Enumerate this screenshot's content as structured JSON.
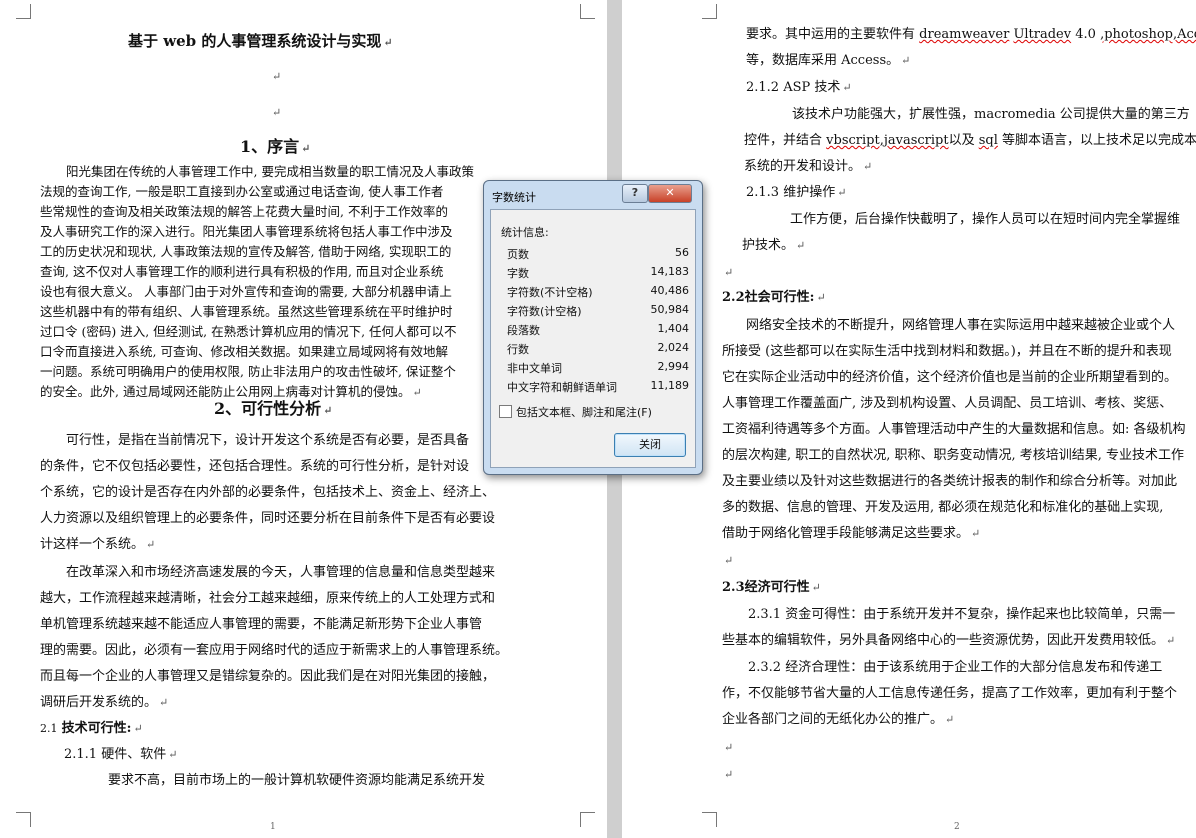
{
  "document": {
    "page1": {
      "title": "基于 web 的人事管理系统设计与实现",
      "section1": "1、序言",
      "intro_lines": [
        "阳光集团在传统的人事管理工作中, 要完成相当数量的职工情况及人事政策",
        "法规的查询工作, 一般是职工直接到办公室或通过电话查询, 使人事工作者",
        "些常规性的查询及相关政策法规的解答上花费大量时间, 不利于工作效率的",
        "及人事研究工作的深入进行。阳光集团人事管理系统将包括人事工作中涉及",
        "工的历史状况和现状, 人事政策法规的宣传及解答, 借助于网络, 实现职工的",
        "查询, 这不仅对人事管理工作的顺利进行具有积极的作用, 而且对企业系统",
        "设也有很大意义。 人事部门由于对外宣传和查询的需要, 大部分机器申请上",
        "这些机器中有的带有组织、人事管理系统。虽然这些管理系统在平时维护时",
        "过口令 (密码) 进入, 但经测试, 在熟悉计算机应用的情况下, 任何人都可以不",
        "口令而直接进入系统, 可查询、修改相关数据。如果建立局域网将有效地解",
        "一问题。系统可明确用户的使用权限, 防止非法用户的攻击性破坏, 保证整个",
        "的安全。此外, 通过局域网还能防止公用网上病毒对计算机的侵蚀。"
      ],
      "section2": "2、可行性分析",
      "feas_lines": [
        "可行性，是指在当前情况下，设计开发这个系统是否有必要，是否具备",
        "的条件，它不仅包括必要性，还包括合理性。系统的可行性分析，是针对设",
        "个系统，它的设计是否存在内外部的必要条件，包括技术上、资金上、经济上、",
        "人力资源以及组织管理上的必要条件，同时还要分析在目前条件下是否有必要设",
        "计这样一个系统。"
      ],
      "reform_lines": [
        "在改革深入和市场经济高速发展的今天，人事管理的信息量和信息类型越来",
        "越大，工作流程越来越清晰，社会分工越来越细，原来传统上的人工处理方式和",
        "单机管理系统越来越不能适应人事管理的需要，不能满足新形势下企业人事管",
        "理的需要。因此，必须有一套应用于网络时代的适应于新需求上的人事管理系统。",
        "而且每一个企业的人事管理又是错综复杂的。因此我们是在对阳光集团的接触，",
        "调研后开发系统的。"
      ],
      "tech_heading_num": "2.1",
      "tech_heading": "技术可行性:",
      "hw_heading": "2.1.1   硬件、软件",
      "hw_line": "要求不高，目前市场上的一般计算机软硬件资源均能满足系统开发",
      "page_number": "1"
    },
    "page2": {
      "req_line_a": "要求。其中运用的主要软件有",
      "req_soft1": "dreamweaver",
      "req_soft2": "Ultradev",
      "req_ver": "4.0",
      "req_soft3": ",photoshop,Acdsee",
      "req_line_b": "等，数据库采用 Access。",
      "asp_heading": "2.1.2   ASP 技术",
      "asp_line1": "该技术户功能强大，扩展性强，macromedia 公司提供大量的第三方",
      "asp_line2a": "控件，并结合",
      "asp_line2b": "vbscript,javascript",
      "asp_line2c": "以及",
      "asp_line2d": "sql",
      "asp_line2e": "等脚本语言，以上技术足以完成本",
      "asp_line3": "系统的开发和设计。",
      "maint_heading": "2.1.3   维护操作",
      "maint_line1": "工作方便，后台操作快截明了，操作人员可以在短时间内完全掌握维",
      "maint_line2": "护技术。",
      "social_num": "2.2",
      "social_heading": "社会可行性:",
      "social_lines": [
        "网络安全技术的不断提升，网络管理人事在实际运用中越来越被企业或个人",
        "所接受 (这些都可以在实际生活中找到材料和数据。)，并且在不断的提升和表现",
        "它在实际企业活动中的经济价值，这个经济价值也是当前的企业所期望看到的。",
        "人事管理工作覆盖面广, 涉及到机构设置、人员调配、员工培训、考核、奖惩、",
        "工资福利待遇等多个方面。人事管理活动中产生的大量数据和信息。如: 各级机构",
        "的层次构建, 职工的自然状况, 职称、职务变动情况, 考核培训结果, 专业技术工作",
        "及主要业绩以及针对这些数据进行的各类统计报表的制作和综合分析等。对加此",
        "多的数据、信息的管理、开发及运用, 都必须在规范化和标准化的基础上实现,",
        "借助于网络化管理手段能够满足这些要求。"
      ],
      "econ_num": "2.3",
      "econ_heading": "经济可行性",
      "fund_line1": "2.3.1 资金可得性：由于系统开发并不复杂，操作起来也比较简单，只需一",
      "fund_line2": "些基本的编辑软件，另外具备网络中心的一些资源优势，因此开发费用较低。",
      "reason_line1": "2.3.2  经济合理性：由于该系统用于企业工作的大部分信息发布和传递工",
      "reason_line2": "作，不仅能够节省大量的人工信息传递任务，提高了工作效率，更加有利于整个",
      "reason_line3": "企业各部门之间的无纸化办公的推广。",
      "page_number": "2"
    },
    "para_mark": "↵"
  },
  "dialog": {
    "title": "字数统计",
    "help_label": "?",
    "close_x_label": "✕",
    "stats_heading": "统计信息:",
    "stats": [
      {
        "label": "页数",
        "value": "56"
      },
      {
        "label": "字数",
        "value": "14,183"
      },
      {
        "label": "字符数(不计空格)",
        "value": "40,486"
      },
      {
        "label": "字符数(计空格)",
        "value": "50,984"
      },
      {
        "label": "段落数",
        "value": "1,404"
      },
      {
        "label": "行数",
        "value": "2,024"
      },
      {
        "label": "非中文单词",
        "value": "2,994"
      },
      {
        "label": "中文字符和朝鲜语单词",
        "value": "11,189"
      }
    ],
    "include_label": "包括文本框、脚注和尾注(F)",
    "close_button": "关闭"
  }
}
